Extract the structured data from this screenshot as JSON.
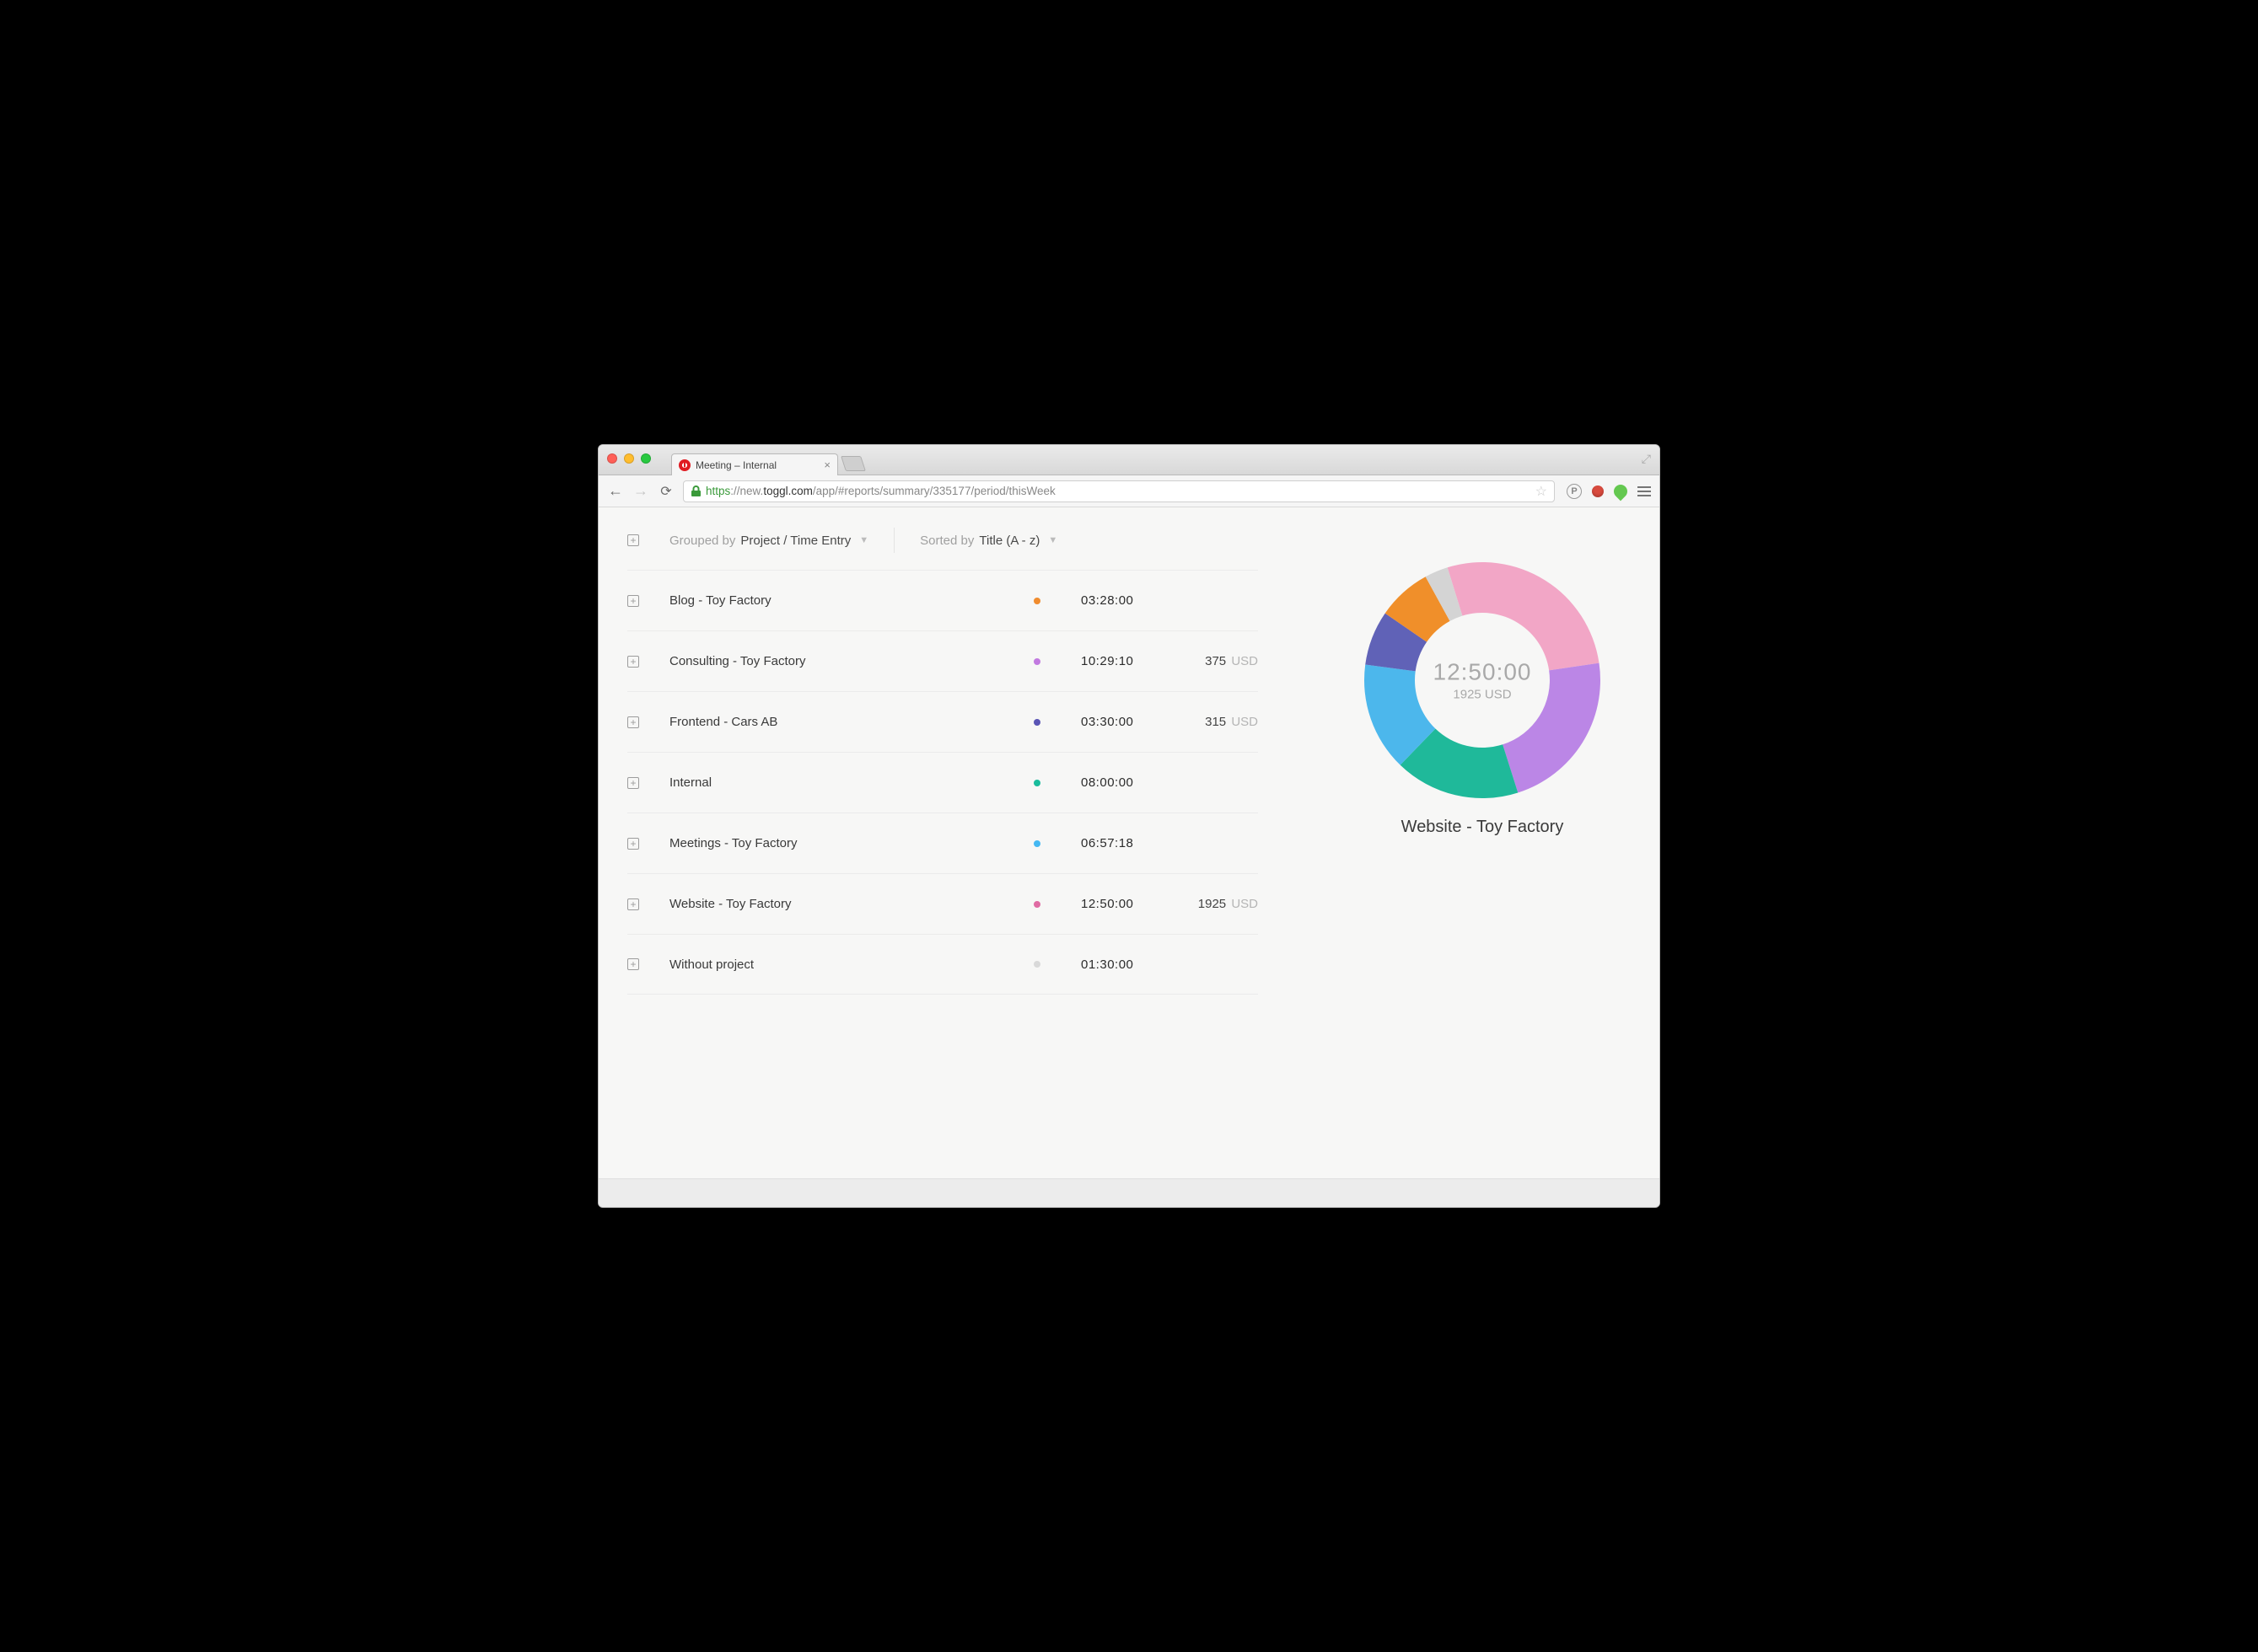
{
  "browser": {
    "tab_title": "Meeting – Internal",
    "url_scheme": "https",
    "url_host_prefix": "://new.",
    "url_host_main": "toggl.com",
    "url_path": "/app/#reports/summary/335177/period/thisWeek"
  },
  "controls": {
    "grouped_label": "Grouped by",
    "grouped_value": "Project / Time Entry",
    "sorted_label": "Sorted by",
    "sorted_value": "Title (A - z)"
  },
  "currency_label": "USD",
  "rows": [
    {
      "name": "Blog - Toy Factory",
      "color": "#f08c2e",
      "time": "03:28:00",
      "amount": ""
    },
    {
      "name": "Consulting - Toy Factory",
      "color": "#c27ae0",
      "time": "10:29:10",
      "amount": "375"
    },
    {
      "name": "Frontend - Cars AB",
      "color": "#5a55b5",
      "time": "03:30:00",
      "amount": "315"
    },
    {
      "name": "Internal",
      "color": "#1abc9c",
      "time": "08:00:00",
      "amount": ""
    },
    {
      "name": "Meetings - Toy Factory",
      "color": "#45b8f2",
      "time": "06:57:18",
      "amount": ""
    },
    {
      "name": "Website - Toy Factory",
      "color": "#e06ba3",
      "time": "12:50:00",
      "amount": "1925"
    },
    {
      "name": "Without project",
      "color": "#d9d9d9",
      "time": "01:30:00",
      "amount": ""
    }
  ],
  "donut": {
    "center_time": "12:50:00",
    "center_amount": "1925 USD",
    "selected_label": "Website - Toy Factory"
  },
  "chart_data": {
    "type": "pie",
    "title": "",
    "series": [
      {
        "name": "Website - Toy Factory",
        "seconds": 46200,
        "display": "12:50:00",
        "color": "#f2a6c6"
      },
      {
        "name": "Consulting - Toy Factory",
        "seconds": 37750,
        "display": "10:29:10",
        "color": "#bb86e6"
      },
      {
        "name": "Internal",
        "seconds": 28800,
        "display": "08:00:00",
        "color": "#1fb99a"
      },
      {
        "name": "Meetings - Toy Factory",
        "seconds": 25038,
        "display": "06:57:18",
        "color": "#4cb7ec"
      },
      {
        "name": "Frontend - Cars AB",
        "seconds": 12600,
        "display": "03:30:00",
        "color": "#6062b7"
      },
      {
        "name": "Blog - Toy Factory",
        "seconds": 12480,
        "display": "03:28:00",
        "color": "#f08f2a"
      },
      {
        "name": "Without project",
        "seconds": 5400,
        "display": "01:30:00",
        "color": "#d4d4d4"
      }
    ],
    "center": {
      "time": "12:50:00",
      "amount_text": "1925 USD"
    },
    "selected": "Website - Toy Factory"
  }
}
